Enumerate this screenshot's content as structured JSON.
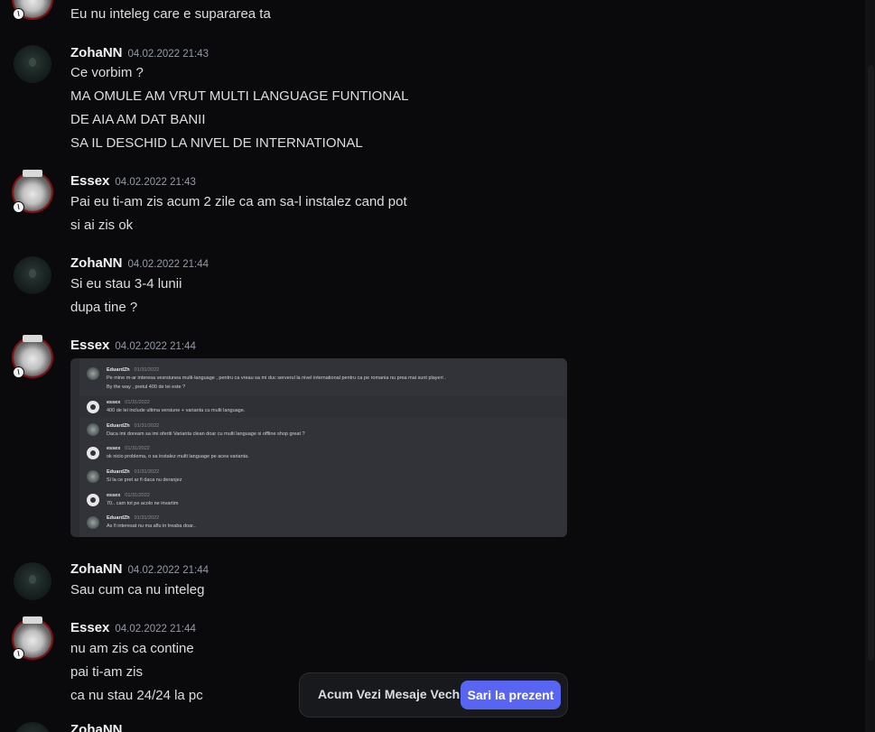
{
  "messages": [
    {
      "lines": [
        "Eu nu inteleg care e supararea ta"
      ]
    },
    {
      "user": "ZohaNN",
      "time": "04.02.2022 21:43",
      "lines": [
        "Ce vorbim ?",
        "MA OMULE AM VRUT MULTI LANGUAGE FUNTIONAL",
        "DE AIA AM DAT BANII",
        "SA IL DESCHID LA NIVEL DE INTERNATIONAL"
      ]
    },
    {
      "user": "Essex",
      "time": "04.02.2022 21:43",
      "lines": [
        "Pai eu ti-am zis acum 2 zile ca am sa-l instalez cand pot",
        "si ai zis ok"
      ]
    },
    {
      "user": "ZohaNN",
      "time": "04.02.2022 21:44",
      "lines": [
        "Si eu stau 3-4 lunii",
        "dupa tine ?"
      ]
    },
    {
      "user": "Essex",
      "time": "04.02.2022 21:44"
    },
    {
      "user": "ZohaNN",
      "time": "04.02.2022 21:44",
      "lines": [
        "Sau cum ca nu inteleg"
      ]
    },
    {
      "user": "Essex",
      "time": "04.02.2022 21:44",
      "lines": [
        "nu am zis ca contine",
        "pai ti-am zis",
        "ca nu stau 24/24 la pc"
      ]
    },
    {
      "user": "ZohaNN"
    }
  ],
  "screenshot": {
    "entries": [
      {
        "user": "EduardZh",
        "date": "01/31/2022",
        "lines": [
          "Pe mine m-ar interesa vesrsiunea multi-language , pentru ca vreau sa mi duc serverul la nivel international pentru ca pe romania nu prea mai sunt playeri .",
          "By the way , pretul 400 de lei este ?"
        ]
      },
      {
        "user": "essex",
        "date": "01/31/2022",
        "lines": [
          "400 de lei include ultima versiune + varianta cu multi language."
        ]
      },
      {
        "user": "EduardZh",
        "date": "01/31/2022",
        "lines": [
          "Daca imi doream sa imi oferiti Varianta clean doar cu multi language si offline shop great ?"
        ]
      },
      {
        "user": "essex",
        "date": "01/31/2022",
        "lines": [
          "ok nicio problema, o sa instalez multi language pe acea varianta."
        ]
      },
      {
        "user": "EduardZh",
        "date": "01/31/2022",
        "lines": [
          "Si la ce pret ar fi daca nu deranjez"
        ]
      },
      {
        "user": "essex",
        "date": "01/31/2022",
        "lines": [
          "70.. cam tot pe acolo ne invartim"
        ]
      },
      {
        "user": "EduardZh",
        "date": "01/31/2022",
        "lines": [
          "As fi interesat nu ma aflu in treaba doar.."
        ]
      }
    ]
  },
  "jump_bar": {
    "label": "Acum Vezi Mesaje Vechi",
    "button": "Sari la prezent"
  },
  "colors": {
    "background": "#0a0a0c",
    "accent": "#5865f2",
    "username": "#f2f3f5",
    "timestamp": "#949ba4"
  },
  "icons": {
    "badge": "moderator-badge-icon"
  }
}
